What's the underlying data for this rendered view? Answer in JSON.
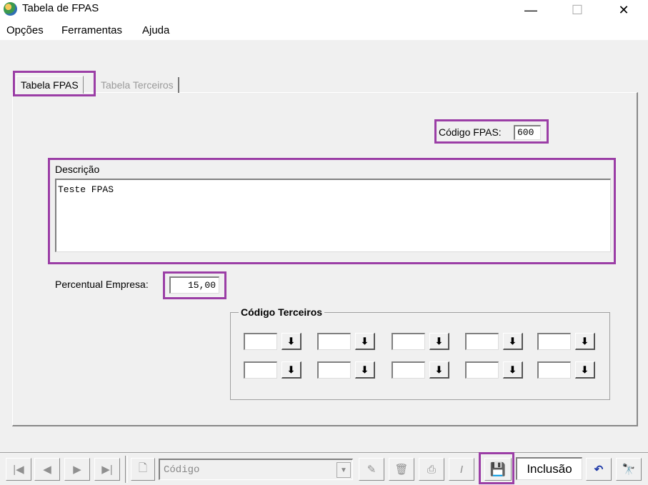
{
  "window": {
    "title": "Tabela de FPAS",
    "minimize": "—",
    "maximize": "☐",
    "close": "✕"
  },
  "menu": [
    "Opções",
    "Ferramentas",
    "Ajuda"
  ],
  "tabs": {
    "active": "Tabela FPAS",
    "inactive": "Tabela Terceiros"
  },
  "form": {
    "codigo_label": "Código FPAS:",
    "codigo_value": "600",
    "descricao_label": "Descrição",
    "descricao_value": "Teste FPAS",
    "percentual_label": "Percentual Empresa:",
    "percentual_value": "15,00",
    "terceiros_title": "Código Terceiros",
    "terceiros_btn": "⬇"
  },
  "toolbar": {
    "first": "|◀",
    "prev": "◀",
    "next": "▶",
    "last": "▶|",
    "search_placeholder": "Código",
    "mode": "Inclusão",
    "undo": "↶",
    "find": "🔭"
  },
  "colors": {
    "highlight": "#9b3ea6",
    "background": "#f0f0f0"
  }
}
